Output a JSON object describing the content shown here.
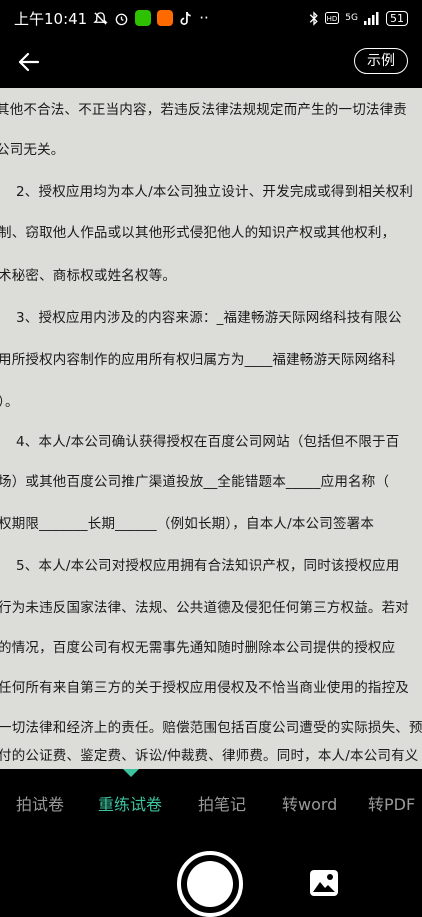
{
  "status_bar": {
    "time": "上午10:41",
    "more": "··",
    "network": "5G",
    "battery": "51"
  },
  "top_bar": {
    "example_label": "示例"
  },
  "document": {
    "lines": [
      "其他不合法、不正当内容，若违反法律法规规定而产生的一切法律责",
      "公司无关。",
      "2、授权应用均为本人/本公司独立设计、开发完成或得到相关权利",
      "制、窃取他人作品或以其他形式侵犯他人的知识产权或其他权利，",
      "术秘密、商标权或姓名权等。",
      "3、授权应用内涉及的内容来源：_福建畅游天际网络科技有限公",
      "用所授权内容制作的应用所有权归属方为____福建畅游天际网络科",
      "）。",
      "4、本人/本公司确认获得授权在百度公司网站（包括但不限于百",
      "场）或其他百度公司推广渠道投放__全能错题本_____应用名称（",
      "权期限_______长期______（例如长期），自本人/本公司签署本",
      "5、本人/本公司对授权应用拥有合法知识产权，同时该授权应用",
      "行为未违反国家法律、法规、公共道德及侵犯任何第三方权益。若对",
      "的情况，百度公司有权无需事先通知随时删除本公司提供的授权应",
      "任何所有来自第三方的关于授权应用侵权及不恰当商业使用的指控及",
      "一切法律和经济上的责任。赔偿范围包括百度公司遭受的实际损失、预",
      "付的公证费、鉴定费、诉讼/仲裁费、律师费。同时，本人/本公司有义"
    ]
  },
  "tabs": [
    {
      "label": "拍试卷",
      "active": false
    },
    {
      "label": "重练试卷",
      "active": true
    },
    {
      "label": "拍笔记",
      "active": false
    },
    {
      "label": "转word",
      "active": false
    },
    {
      "label": "转PDF",
      "active": false
    }
  ],
  "colors": {
    "accent": "#3dc39d",
    "background": "#000000",
    "inactive_tab": "#999999"
  },
  "icons": [
    "back-arrow-icon",
    "shutter-icon",
    "gallery-icon",
    "bluetooth-icon",
    "wifi-icon",
    "signal-icon",
    "alarm-icon",
    "mute-icon"
  ]
}
